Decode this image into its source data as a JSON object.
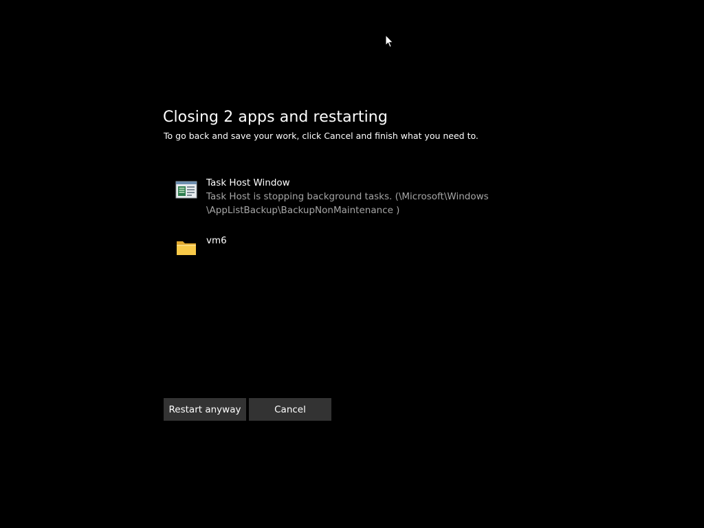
{
  "dialog": {
    "title": "Closing 2 apps and restarting",
    "subtitle": "To go back and save your work, click Cancel and finish what you need to."
  },
  "apps": [
    {
      "icon": "task-host-window-icon",
      "name": "Task Host Window",
      "description_line1": "Task Host is stopping background tasks. (\\Microsoft\\Windows",
      "description_line2": "\\AppListBackup\\BackupNonMaintenance )"
    },
    {
      "icon": "folder-icon",
      "name": "vm6"
    }
  ],
  "buttons": {
    "restart_label": "Restart anyway",
    "cancel_label": "Cancel"
  },
  "colors": {
    "background": "#000000",
    "text": "#ffffff",
    "secondary_text": "#a6a6a6",
    "button_bg": "#333333",
    "folder": "#f8c948"
  }
}
